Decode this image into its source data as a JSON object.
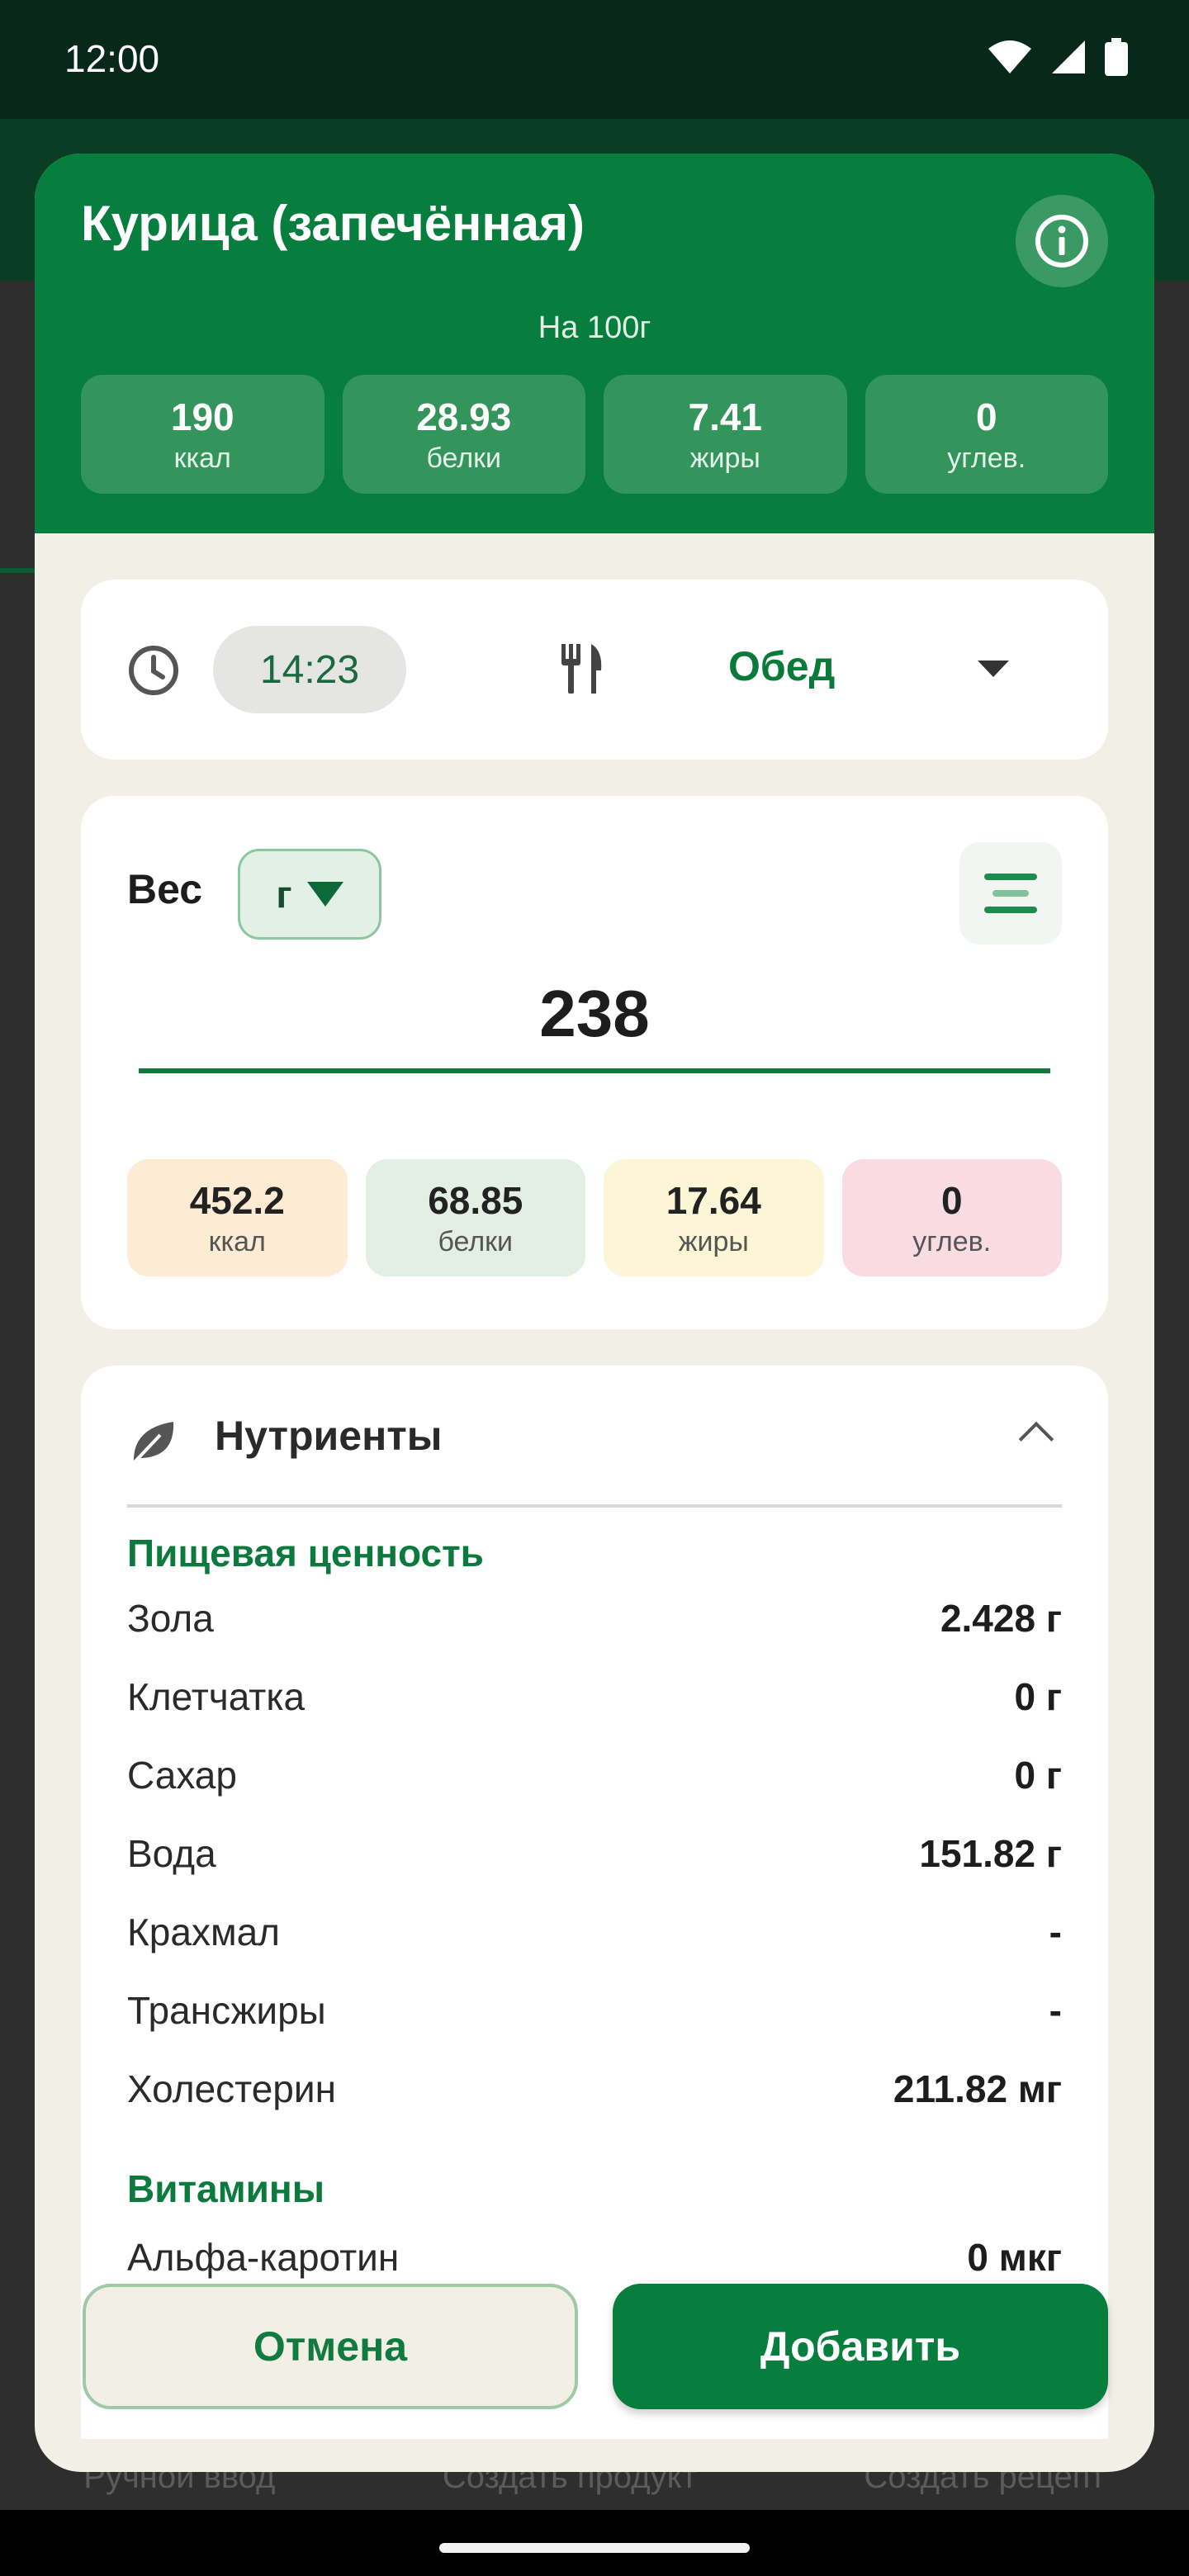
{
  "status_bar": {
    "time": "12:00"
  },
  "background": {
    "bottom_nav": [
      "Ручной ввод",
      "Создать продукт",
      "Создать рецепт"
    ]
  },
  "product": {
    "title": "Курица (запечённая)",
    "per_label": "На 100г",
    "macros": [
      {
        "value": "190",
        "label": "ккал"
      },
      {
        "value": "28.93",
        "label": "белки"
      },
      {
        "value": "7.41",
        "label": "жиры"
      },
      {
        "value": "0",
        "label": "углев."
      }
    ]
  },
  "meal": {
    "time": "14:23",
    "name": "Обед"
  },
  "weight": {
    "label": "Вес",
    "unit": "г",
    "value": "238",
    "macros": [
      {
        "value": "452.2",
        "label": "ккал",
        "color": "#fdebd3"
      },
      {
        "value": "68.85",
        "label": "белки",
        "color": "#e3efe4"
      },
      {
        "value": "17.64",
        "label": "жиры",
        "color": "#fdf6d6"
      },
      {
        "value": "0",
        "label": "углев.",
        "color": "#f9dbe3"
      }
    ]
  },
  "nutrients": {
    "title": "Нутриенты",
    "sections": [
      {
        "title": "Пищевая ценность",
        "rows": [
          {
            "name": "Зола",
            "value": "2.428 г"
          },
          {
            "name": "Клетчатка",
            "value": "0 г"
          },
          {
            "name": "Сахар",
            "value": "0 г"
          },
          {
            "name": "Вода",
            "value": "151.82 г"
          },
          {
            "name": "Крахмал",
            "value": "-"
          },
          {
            "name": "Трансжиры",
            "value": "-"
          },
          {
            "name": "Холестерин",
            "value": "211.82 мг"
          }
        ]
      },
      {
        "title": "Витамины",
        "rows": [
          {
            "name": "Альфа-каротин",
            "value": "0 мкг"
          }
        ]
      }
    ]
  },
  "buttons": {
    "cancel": "Отмена",
    "add": "Добавить"
  },
  "colors": {
    "brand_green": "#077e3d",
    "status_bar": "#07281a",
    "sheet_bg": "#f2efe7"
  }
}
